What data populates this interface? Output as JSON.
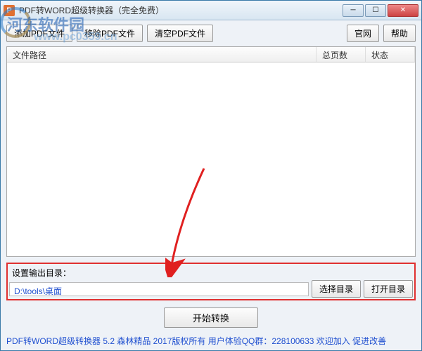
{
  "window": {
    "title": "PDF转WORD超级转换器（完全免费）",
    "icon_letter": "P"
  },
  "toolbar": {
    "add_file": "添加PDF文件",
    "remove_file": "移除PDF文件",
    "clear_files": "清空PDF文件",
    "official_site": "官网",
    "help": "帮助"
  },
  "list": {
    "col_path": "文件路径",
    "col_pages": "总页数",
    "col_status": "状态"
  },
  "output": {
    "label": "设置输出目录：",
    "path": "D:\\tools\\桌面",
    "choose_dir": "选择目录",
    "open_dir": "打开目录"
  },
  "actions": {
    "start": "开始转换"
  },
  "footer": {
    "text": "PDF转WORD超级转换器 5.2 森林精品 2017版权所有 用户体验QQ群：228100633  欢迎加入 促进改善"
  },
  "watermark": {
    "line1": "河东软件园",
    "line2": "www.pc0359.cn"
  }
}
